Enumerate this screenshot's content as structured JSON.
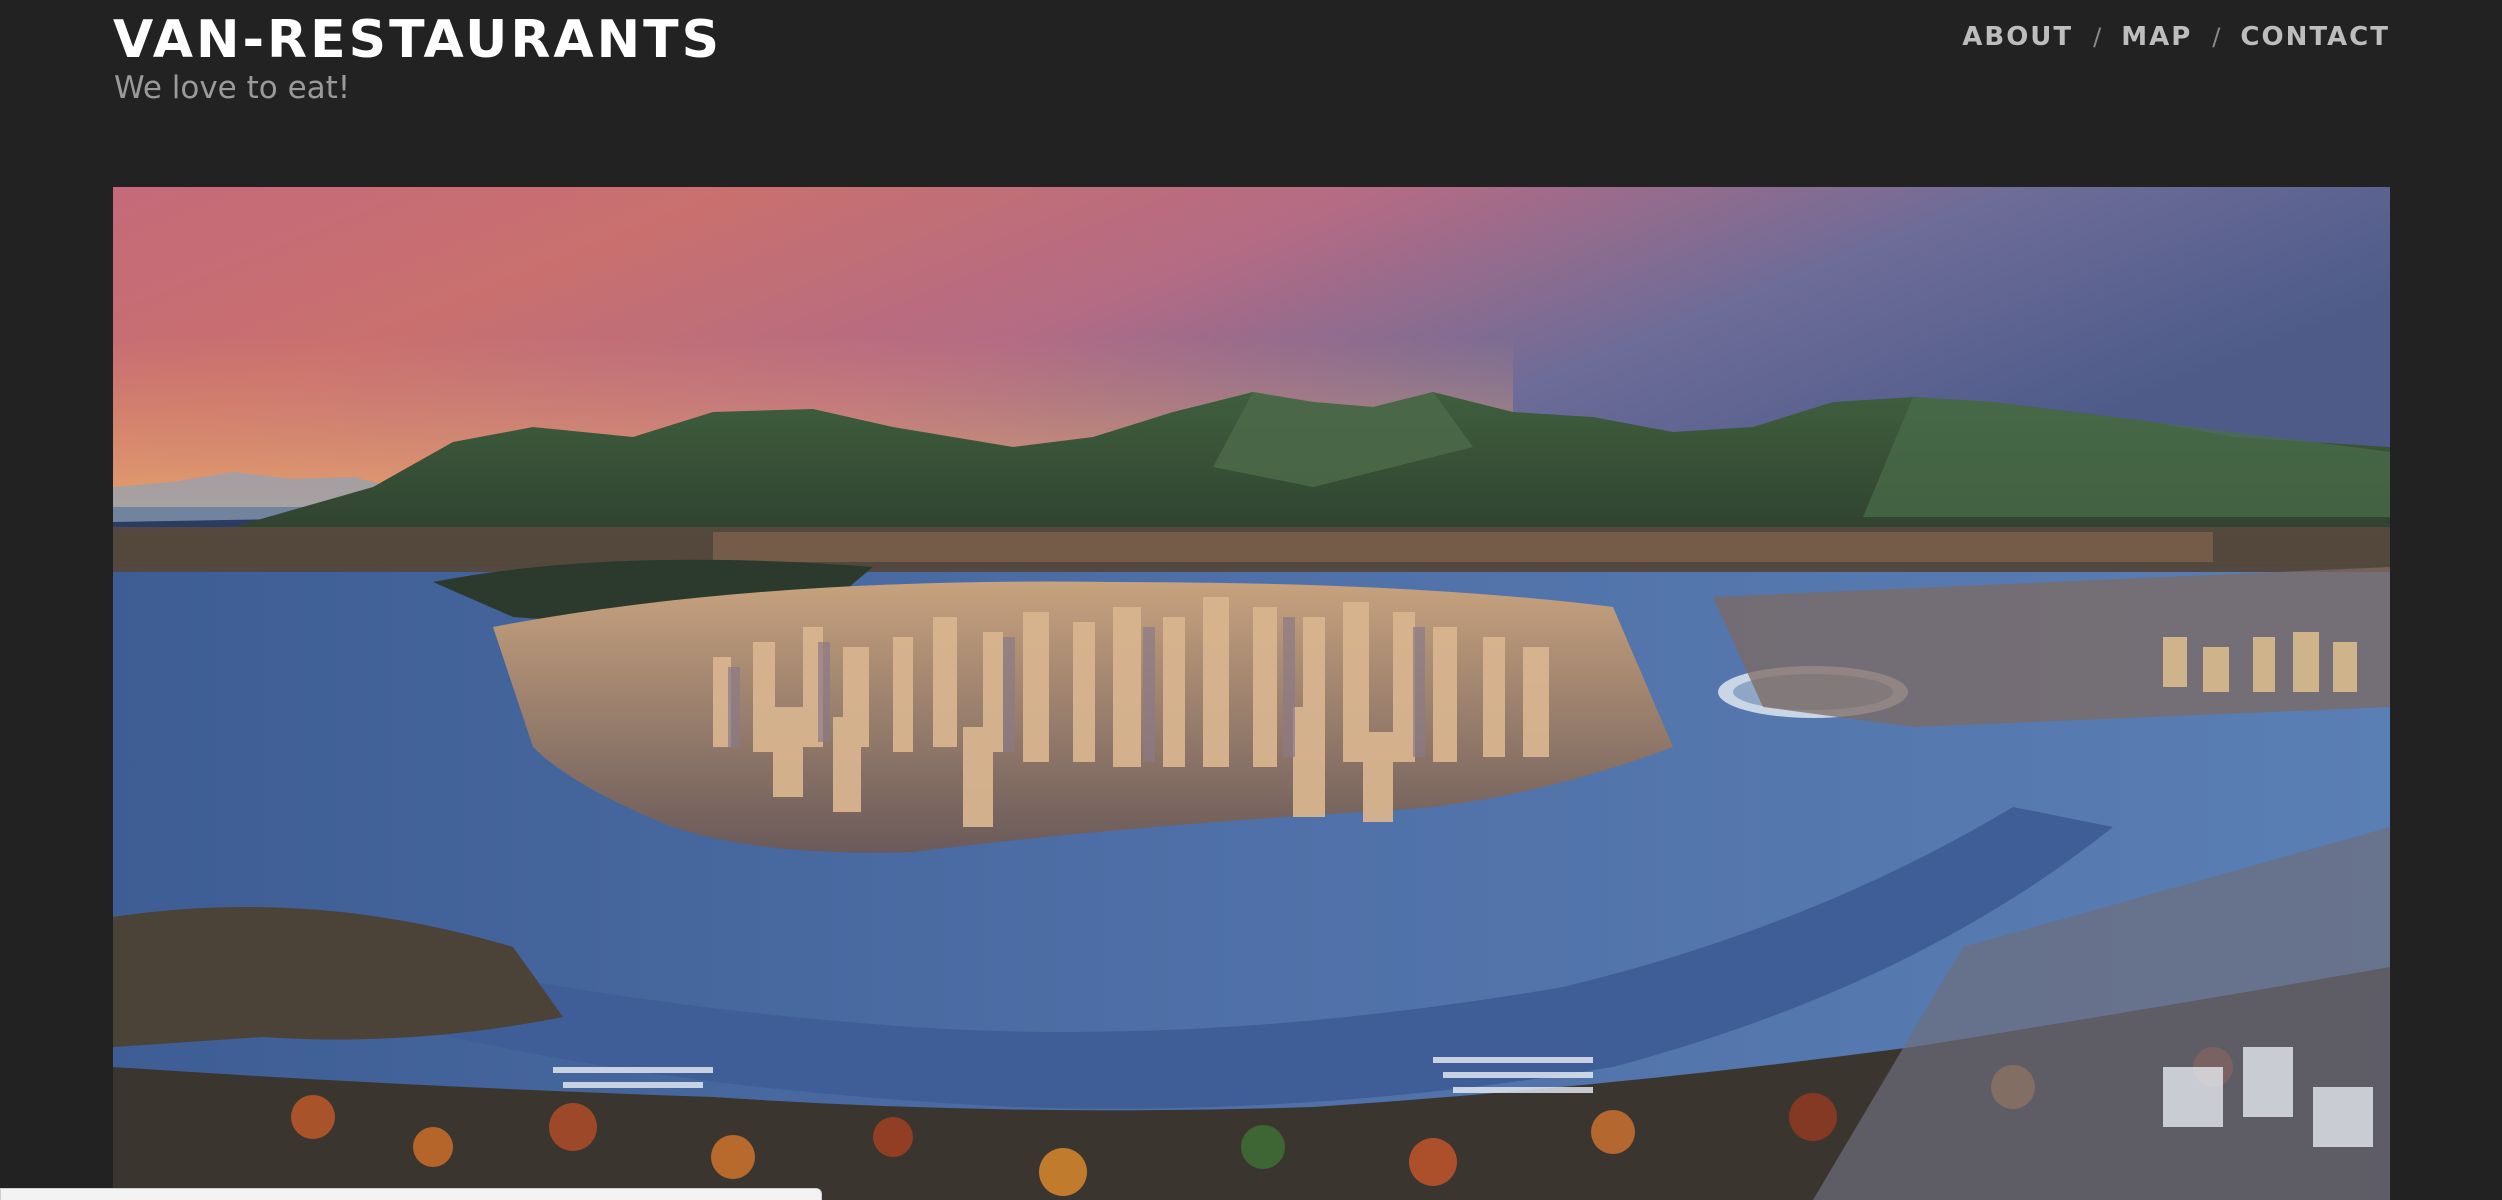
{
  "site": {
    "title": "VAN-RESTAURANTS",
    "tagline": "We love to eat!"
  },
  "nav": {
    "items": [
      {
        "label": "ABOUT"
      },
      {
        "label": "MAP"
      },
      {
        "label": "CONTACT"
      }
    ],
    "separator": "/"
  },
  "hero": {
    "image_subject": "aerial sunset view of Vancouver skyline with mountains and harbour"
  },
  "colors": {
    "background": "#222222",
    "title": "#ffffff",
    "tagline": "#9a9a9a",
    "nav_link": "#bdbdbd"
  }
}
